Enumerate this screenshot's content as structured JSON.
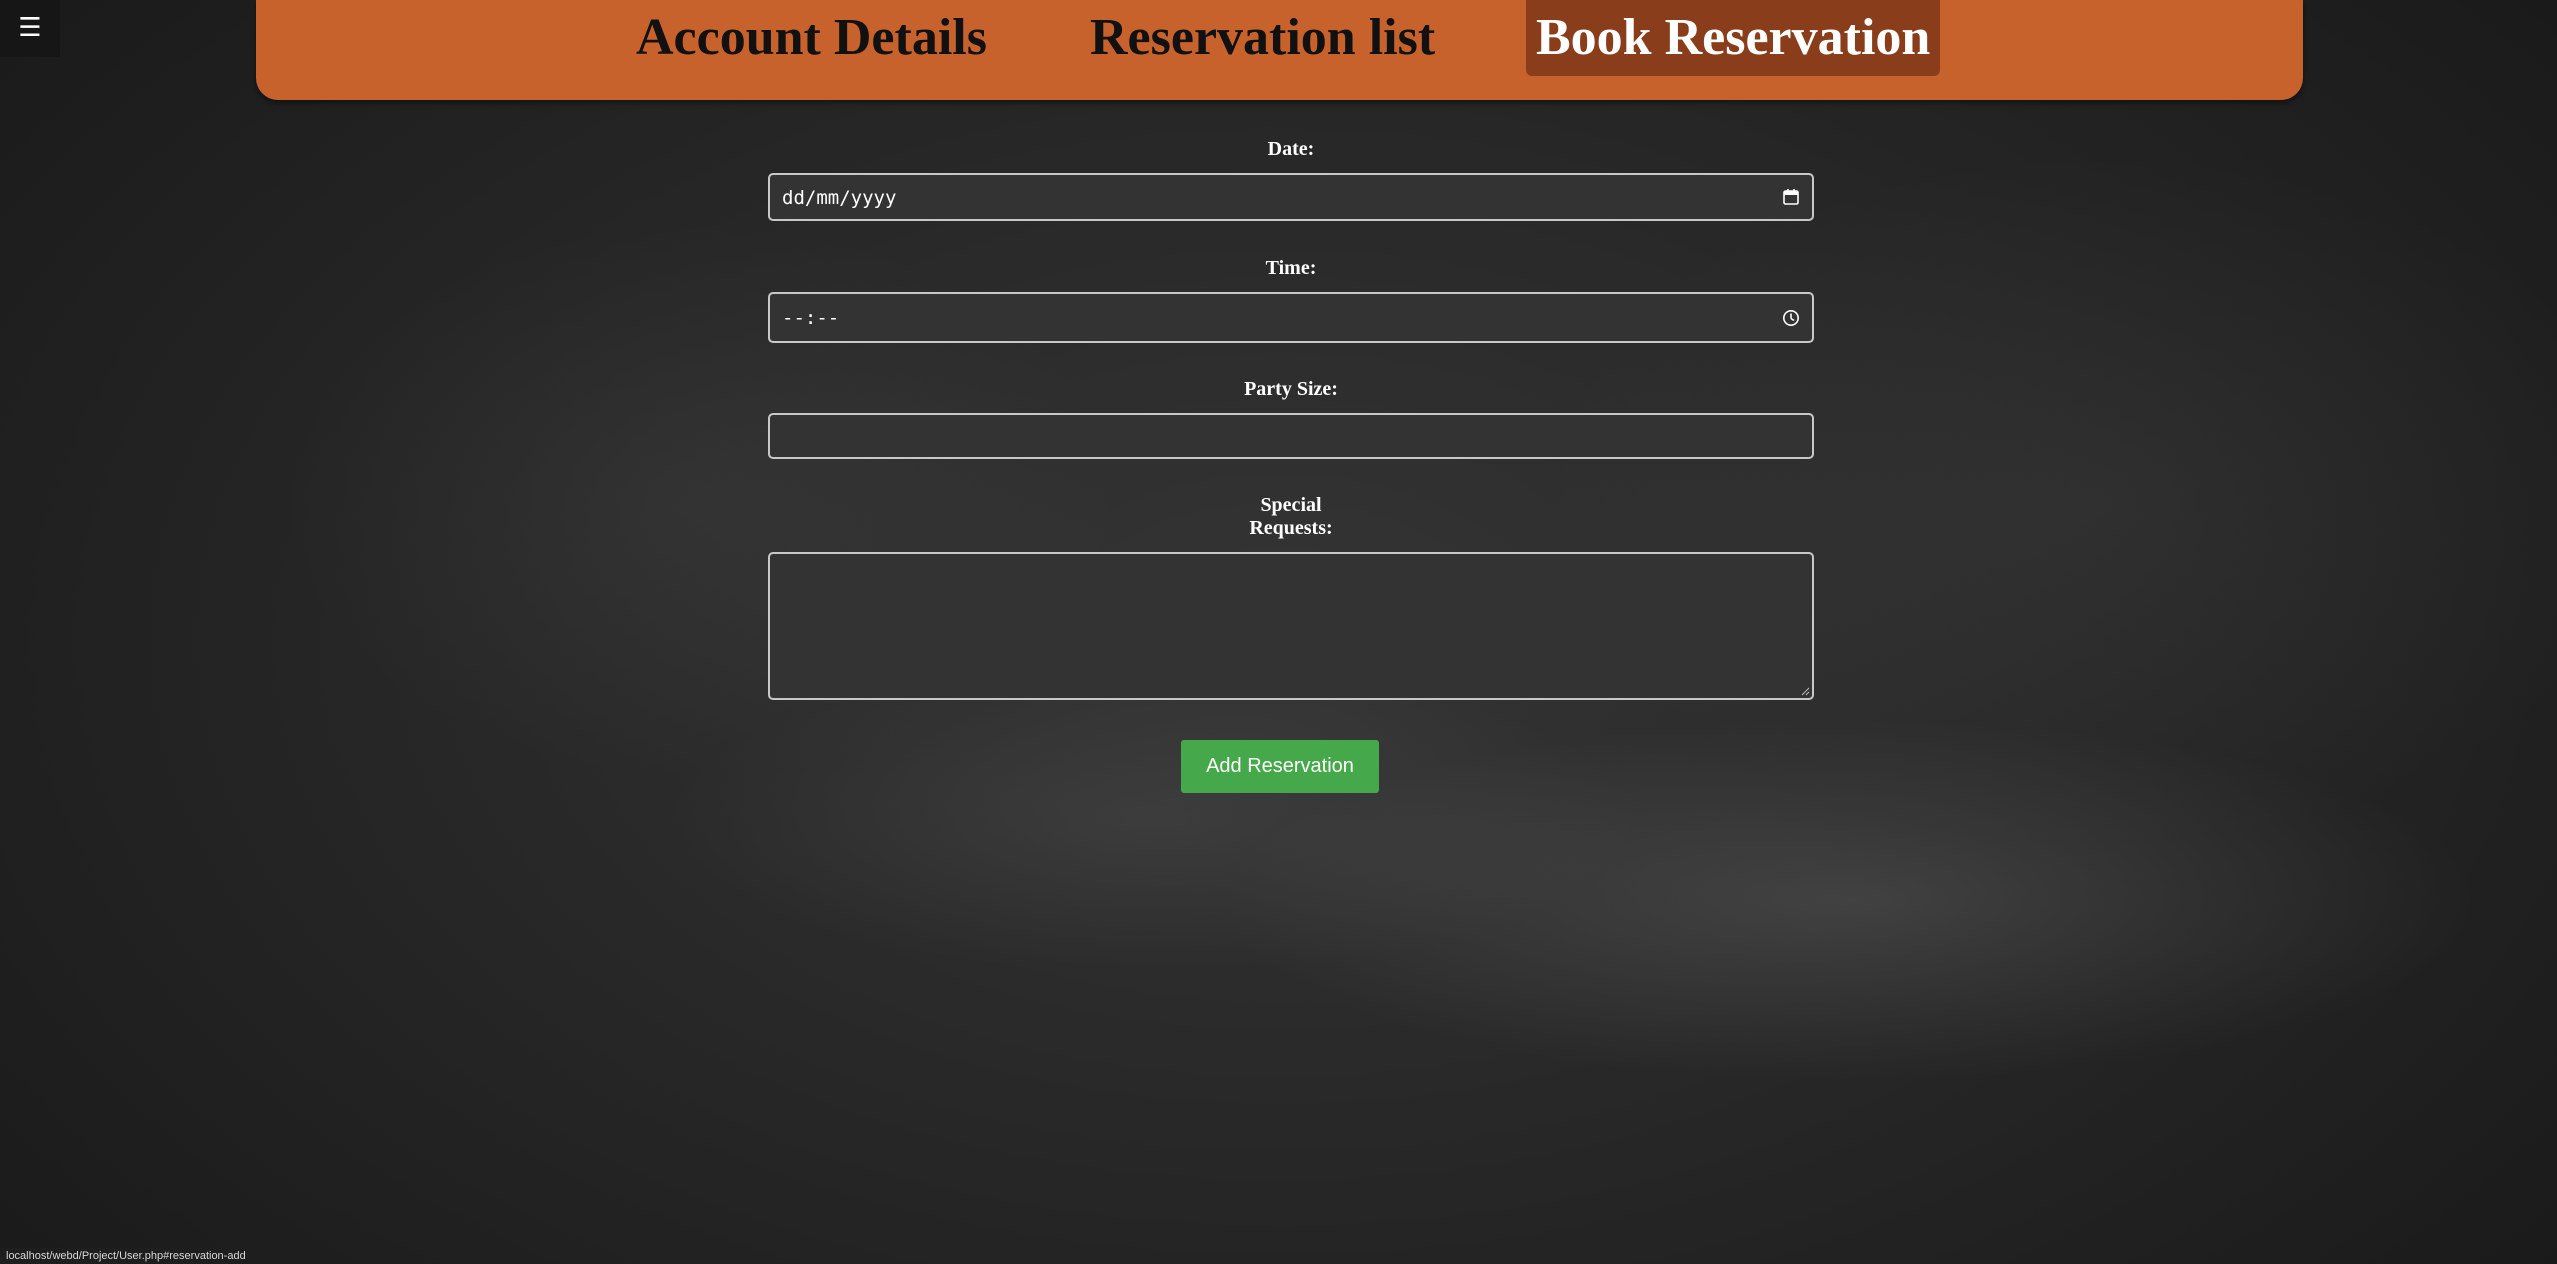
{
  "menu_toggle": {
    "icon": "☰"
  },
  "nav": {
    "items": [
      {
        "label": "Account Details"
      },
      {
        "label": "Reservation list"
      },
      {
        "label": "Book Reservation",
        "active": true
      }
    ]
  },
  "form": {
    "date": {
      "label": "Date:",
      "placeholder": "dd/mm/yyyy",
      "value": ""
    },
    "time": {
      "label": "Time:",
      "placeholder": "--:--",
      "value": ""
    },
    "party_size": {
      "label": "Party Size:",
      "value": ""
    },
    "special_requests": {
      "label_line1": "Special",
      "label_line2": "Requests:",
      "value": ""
    },
    "submit_label": "Add Reservation"
  },
  "status_bar": {
    "url": "localhost/webd/Project/User.php#reservation-add"
  },
  "colors": {
    "nav_background": "#c8622d",
    "nav_active": "#8a3d1a",
    "submit_button": "#45a84a",
    "field_background": "#333333"
  }
}
